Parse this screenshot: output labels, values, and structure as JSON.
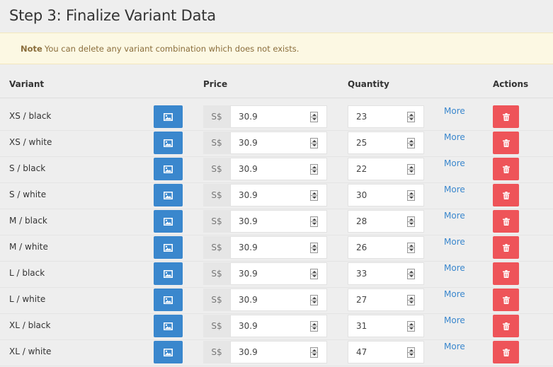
{
  "page": {
    "title": "Step 3: Finalize Variant Data"
  },
  "note": {
    "label": "Note",
    "text": "You can delete any variant combination which does not exists."
  },
  "table": {
    "headers": {
      "variant": "Variant",
      "price": "Price",
      "quantity": "Quantity",
      "actions": "Actions"
    },
    "currency_prefix": "S$",
    "more_label": "More",
    "rows": [
      {
        "variant": "XS / black",
        "price": "30.9",
        "quantity": "23"
      },
      {
        "variant": "XS / white",
        "price": "30.9",
        "quantity": "25"
      },
      {
        "variant": "S / black",
        "price": "30.9",
        "quantity": "22"
      },
      {
        "variant": "S / white",
        "price": "30.9",
        "quantity": "30"
      },
      {
        "variant": "M / black",
        "price": "30.9",
        "quantity": "28"
      },
      {
        "variant": "M / white",
        "price": "30.9",
        "quantity": "26"
      },
      {
        "variant": "L / black",
        "price": "30.9",
        "quantity": "33"
      },
      {
        "variant": "L / white",
        "price": "30.9",
        "quantity": "27"
      },
      {
        "variant": "XL / black",
        "price": "30.9",
        "quantity": "31"
      },
      {
        "variant": "XL / white",
        "price": "30.9",
        "quantity": "47"
      }
    ]
  },
  "colors": {
    "image_button": "#3a87cd",
    "delete_button": "#ee5459",
    "link": "#3a87cd",
    "note_background": "#fcf8e3"
  },
  "icons": {
    "image": "image-icon",
    "delete": "trash-icon"
  }
}
